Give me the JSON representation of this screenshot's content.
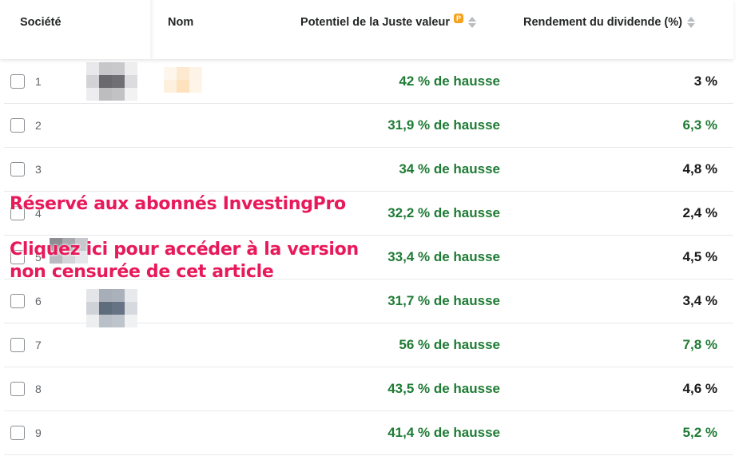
{
  "header": {
    "col_societe": "Société",
    "col_nom": "Nom",
    "col_fair_value": "Potentiel de la Juste valeur",
    "col_dividend": "Rendement du dividende (%)",
    "pro_badge_icon": "investingpro-badge-icon",
    "sort_icon": "sort-arrows-icon"
  },
  "colors": {
    "positive_green": "#1e7b34",
    "dividend_green": "#1e7b34",
    "overlay_pink": "#e8195a"
  },
  "rows": [
    {
      "rank": "1",
      "fair_value": "42 % de hausse",
      "dividend": "3 %",
      "dividend_color": "#1a1a1a"
    },
    {
      "rank": "2",
      "fair_value": "31,9 % de hausse",
      "dividend": "6,3 %",
      "dividend_color": "#1e7b34"
    },
    {
      "rank": "3",
      "fair_value": "34 % de hausse",
      "dividend": "4,8 %",
      "dividend_color": "#1a1a1a"
    },
    {
      "rank": "4",
      "fair_value": "32,2 % de hausse",
      "dividend": "2,4 %",
      "dividend_color": "#1a1a1a"
    },
    {
      "rank": "5",
      "fair_value": "33,4 % de hausse",
      "dividend": "4,5 %",
      "dividend_color": "#1a1a1a"
    },
    {
      "rank": "6",
      "fair_value": "31,7 % de hausse",
      "dividend": "3,4 %",
      "dividend_color": "#1a1a1a"
    },
    {
      "rank": "7",
      "fair_value": "56 % de hausse",
      "dividend": "7,8 %",
      "dividend_color": "#1e7b34"
    },
    {
      "rank": "8",
      "fair_value": "43,5 % de hausse",
      "dividend": "4,6 %",
      "dividend_color": "#1a1a1a"
    },
    {
      "rank": "9",
      "fair_value": "41,4 % de hausse",
      "dividend": "5,2 %",
      "dividend_color": "#1e7b34"
    }
  ],
  "overlay": {
    "line1": "Réservé aux abonnés InvestingPro",
    "line2": "Cliquez ici pour accéder à la version",
    "line3": "non censurée de cet article"
  }
}
